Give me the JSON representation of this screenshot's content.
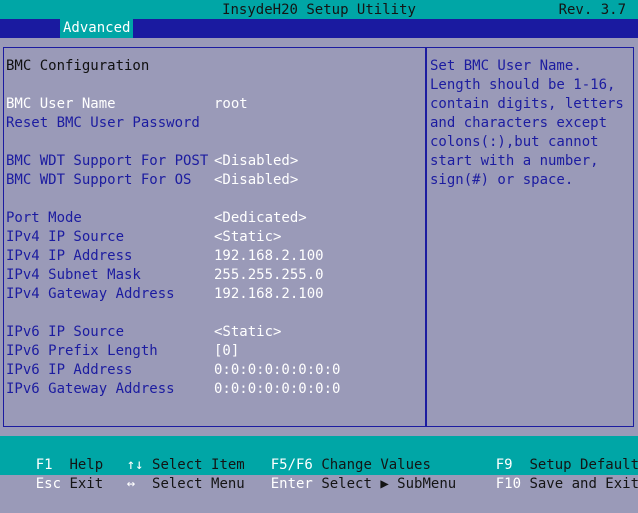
{
  "title": "InsydeH20 Setup Utility",
  "revision": "Rev. 3.7",
  "tab": "Advanced",
  "heading": "BMC Configuration",
  "rows": [
    {
      "label": "BMC User Name",
      "value": "root",
      "selected": true
    },
    {
      "label": "Reset BMC User Password",
      "value": ""
    },
    {
      "label": "BMC WDT Support For POST",
      "value": "<Disabled>"
    },
    {
      "label": "BMC WDT Support For OS",
      "value": "<Disabled>"
    },
    {
      "label": "Port Mode",
      "value": "<Dedicated>"
    },
    {
      "label": "IPv4 IP Source",
      "value": "<Static>"
    },
    {
      "label": "IPv4 IP Address",
      "value": "192.168.2.100"
    },
    {
      "label": "IPv4 Subnet Mask",
      "value": "255.255.255.0"
    },
    {
      "label": "IPv4 Gateway Address",
      "value": "192.168.2.100"
    },
    {
      "label": "IPv6 IP Source",
      "value": "<Static>"
    },
    {
      "label": "IPv6 Prefix Length",
      "value": "[0]"
    },
    {
      "label": "IPv6 IP Address",
      "value": "0:0:0:0:0:0:0:0"
    },
    {
      "label": "IPv6 Gateway Address",
      "value": "0:0:0:0:0:0:0:0"
    }
  ],
  "help": [
    "Set BMC User Name.",
    "Length should be 1-16,",
    "contain digits, letters",
    "and characters except",
    "colons(:),but cannot",
    "start with a number,",
    "sign(#) or space."
  ],
  "footer": [
    {
      "key": "F1",
      "action": "Help"
    },
    {
      "key": "Esc",
      "action": "Exit"
    },
    {
      "key": "↑↓",
      "action": "Select Item"
    },
    {
      "key": "↔",
      "action": "Select Menu"
    },
    {
      "key": "F5/F6",
      "action": "Change Values"
    },
    {
      "key": "Enter",
      "action": "Select ▶ SubMenu"
    },
    {
      "key": "F9",
      "action": "Setup Defaults"
    },
    {
      "key": "F10",
      "action": "Save and Exit"
    }
  ]
}
